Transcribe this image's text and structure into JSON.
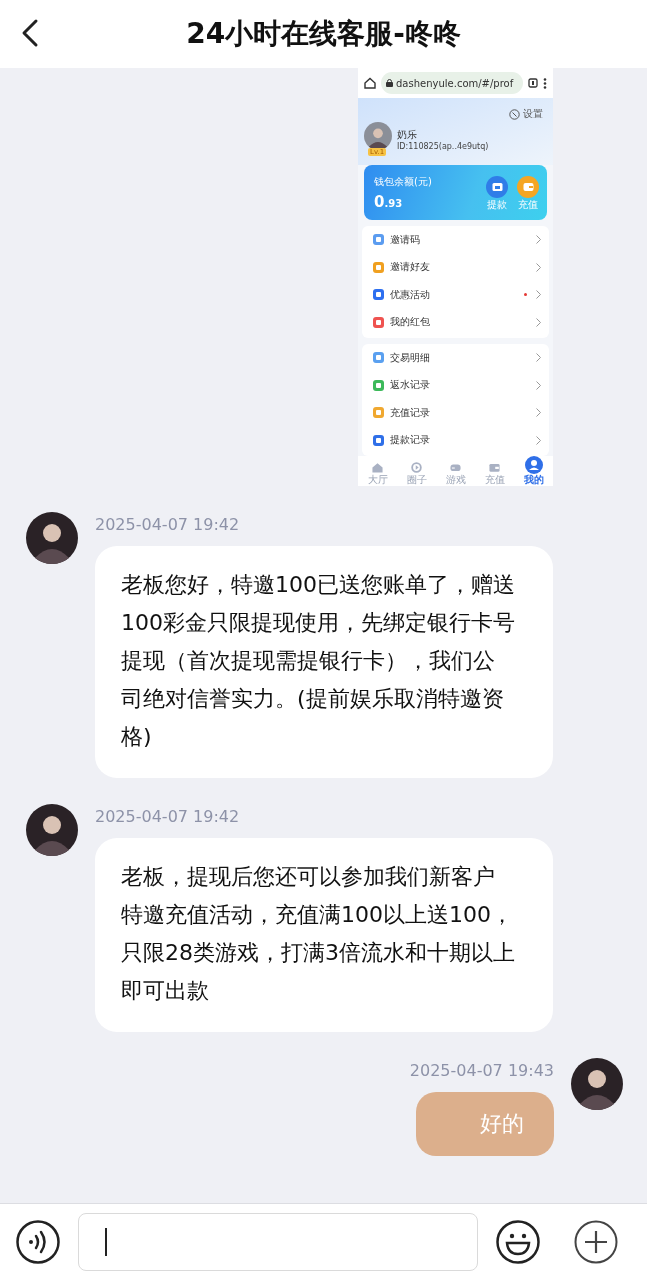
{
  "header": {
    "title": "24小时在线客服-咚咚"
  },
  "messages": [
    {
      "kind": "image",
      "screenshot": {
        "browser": {
          "url": "dashenyule.com/#/prof"
        },
        "settings_label": "设置",
        "profile": {
          "name": "奶乐",
          "level_badge": "Lv.1",
          "id": "ID:110825(ap..4e9utq)"
        },
        "wallet": {
          "label": "钱包余额(元)",
          "balance_whole": "0",
          "balance_fraction": ".93",
          "actions": [
            {
              "label": "提款",
              "color": "#2f7de8"
            },
            {
              "label": "充值",
              "color": "#f5a623"
            }
          ]
        },
        "menu_groups": [
          [
            {
              "label": "邀请码",
              "color": "#5b9cf0",
              "dot": false
            },
            {
              "label": "邀请好友",
              "color": "#f0a020",
              "dot": false
            },
            {
              "label": "优惠活动",
              "color": "#2d6ff0",
              "dot": true
            },
            {
              "label": "我的红包",
              "color": "#ef5350",
              "dot": false
            }
          ],
          [
            {
              "label": "交易明细",
              "color": "#5aa0f0",
              "dot": false
            },
            {
              "label": "返水记录",
              "color": "#3cb95a",
              "dot": false
            },
            {
              "label": "充值记录",
              "color": "#f0a830",
              "dot": false
            },
            {
              "label": "提款记录",
              "color": "#2f6fe8",
              "dot": false
            }
          ]
        ],
        "tabs": [
          {
            "label": "大厅",
            "selected": false
          },
          {
            "label": "圈子",
            "selected": false
          },
          {
            "label": "游戏",
            "selected": false
          },
          {
            "label": "充值",
            "selected": false
          },
          {
            "label": "我的",
            "selected": true
          }
        ]
      }
    },
    {
      "kind": "text",
      "outgoing": false,
      "time": "2025-04-07 19:42",
      "text": "老板您好，特邀100已送您账单了，赠送100彩金只限提现使用，先绑定银行卡号提现（首次提现需提银行卡），我们公司绝对信誉实力。(提前娱乐取消特邀资格)"
    },
    {
      "kind": "text",
      "outgoing": false,
      "time": "2025-04-07 19:42",
      "text": "老板，提现后您还可以参加我们新客户特邀充值活动，充值满100以上送100，只限28类游戏，打满3倍流水和十期以上即可出款"
    },
    {
      "kind": "text",
      "outgoing": true,
      "time": "2025-04-07 19:43",
      "text": "好的"
    }
  ],
  "composer": {
    "focused": true
  }
}
